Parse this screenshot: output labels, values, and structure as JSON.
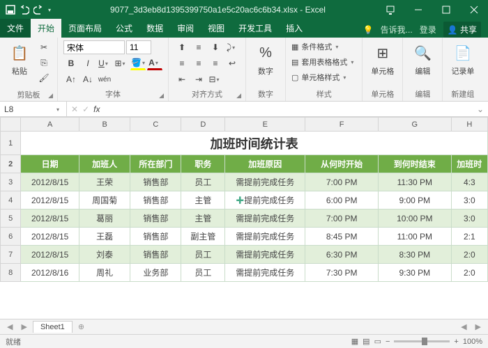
{
  "title": "9077_3d3eb8d1395399750a1e5c20ac6c6b34.xlsx - Excel",
  "tabs": {
    "file": "文件",
    "home": "开始",
    "layout": "页面布局",
    "formula": "公式",
    "data": "数据",
    "review": "审阅",
    "view": "视图",
    "dev": "开发工具",
    "insert": "插入"
  },
  "tellme": "告诉我...",
  "login": "登录",
  "share": "共享",
  "ribbon": {
    "clipboard": {
      "label": "剪贴板",
      "paste": "粘贴"
    },
    "font": {
      "label": "字体",
      "name": "宋体",
      "size": "11"
    },
    "align": {
      "label": "对齐方式"
    },
    "number": {
      "label": "数字",
      "btn": "数字"
    },
    "styles": {
      "label": "样式",
      "cond": "条件格式",
      "table": "套用表格格式",
      "cell": "单元格样式"
    },
    "cells": {
      "label": "单元格",
      "btn": "单元格"
    },
    "editing": {
      "label": "编辑",
      "btn": "编辑"
    },
    "record": {
      "label": "新建组",
      "btn": "记录单"
    }
  },
  "namebox": "L8",
  "cols": [
    "",
    "A",
    "B",
    "C",
    "D",
    "E",
    "F",
    "G",
    "H"
  ],
  "table_title": "加班时间统计表",
  "headers": [
    "日期",
    "加班人",
    "所在部门",
    "职务",
    "加班原因",
    "从何时开始",
    "到何时结束",
    "加班时"
  ],
  "rows": [
    {
      "n": "3",
      "c": [
        "2012/8/15",
        "王荣",
        "销售部",
        "员工",
        "需提前完成任务",
        "7:00 PM",
        "11:30 PM",
        "4:3"
      ]
    },
    {
      "n": "4",
      "c": [
        "2012/8/15",
        "周国菊",
        "销售部",
        "主管",
        "需提前完成任务",
        "6:00 PM",
        "9:00 PM",
        "3:0"
      ]
    },
    {
      "n": "5",
      "c": [
        "2012/8/15",
        "葛丽",
        "销售部",
        "主管",
        "需提前完成任务",
        "7:00 PM",
        "10:00 PM",
        "3:0"
      ]
    },
    {
      "n": "6",
      "c": [
        "2012/8/15",
        "王磊",
        "销售部",
        "副主管",
        "需提前完成任务",
        "8:45 PM",
        "11:00 PM",
        "2:1"
      ]
    },
    {
      "n": "7",
      "c": [
        "2012/8/15",
        "刘泰",
        "销售部",
        "员工",
        "需提前完成任务",
        "6:30 PM",
        "8:30 PM",
        "2:0"
      ]
    },
    {
      "n": "8",
      "c": [
        "2012/8/16",
        "周礼",
        "业务部",
        "员工",
        "需提前完成任务",
        "7:30 PM",
        "9:30 PM",
        "2:0"
      ]
    }
  ],
  "sheet": "Sheet1",
  "status": "就绪",
  "zoom": "100%"
}
